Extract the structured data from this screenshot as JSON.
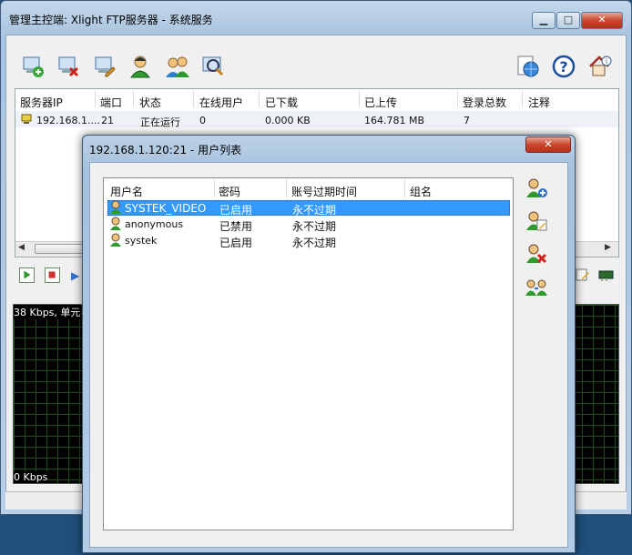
{
  "main_window": {
    "title": "管理主控端: Xlight FTP服务器 - 系统服务",
    "min_label": "▁",
    "max_label": "□",
    "close_label": "✕"
  },
  "toolbar": {
    "icons": [
      "add-server-icon",
      "delete-server-icon",
      "edit-server-icon",
      "user-icon",
      "users-icon",
      "search-icon",
      "globe-icon",
      "help-icon",
      "home-info-icon"
    ]
  },
  "server_list": {
    "columns": [
      "服务器IP",
      "端口",
      "状态",
      "在线用户",
      "已下载",
      "已上传",
      "登录总数",
      "注释"
    ],
    "rows": [
      [
        "192.168.1....",
        "21",
        "正在运行",
        "0",
        "0.000 KB",
        "164.781 MB",
        "7",
        ""
      ]
    ]
  },
  "graph": {
    "top_label": "38 Kbps, 单元=",
    "bottom_label": "0 Kbps"
  },
  "dialog": {
    "title": "192.168.1.120:21 - 用户列表",
    "close_label": "✕",
    "columns": [
      "用户名",
      "密码",
      "账号过期时间",
      "组名"
    ],
    "users": [
      {
        "name": "SYSTEK_VIDEO",
        "password": "已启用",
        "expiry": "永不过期",
        "group": "",
        "selected": true
      },
      {
        "name": "anonymous",
        "password": "已禁用",
        "expiry": "永不过期",
        "group": "",
        "selected": false
      },
      {
        "name": "systek",
        "password": "已启用",
        "expiry": "永不过期",
        "group": "",
        "selected": false
      }
    ],
    "side_buttons": [
      "add-user-icon",
      "edit-user-icon",
      "delete-user-icon",
      "copy-user-icon"
    ]
  },
  "colors": {
    "selection": "#3399ff",
    "graph_grid": "#0a5a0a",
    "title_bar": "#b3cbe3"
  }
}
